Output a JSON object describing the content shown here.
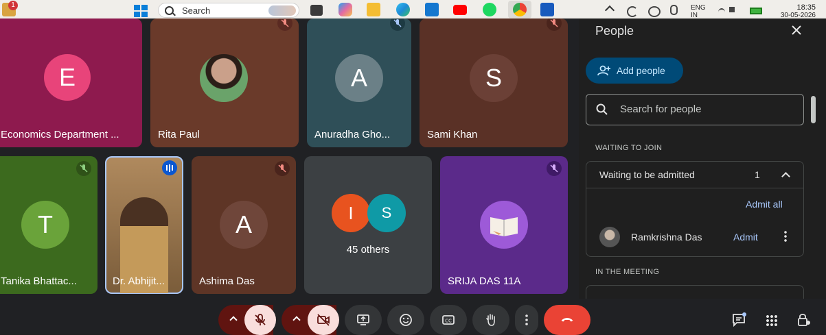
{
  "taskbar": {
    "notification_count": "1",
    "search_label": "Search",
    "lang_line1": "ENG",
    "lang_line2": "IN",
    "time": "18:35",
    "date": "30-05-2026"
  },
  "tiles": [
    {
      "name": "Economics Department ...",
      "initial": "E"
    },
    {
      "name": "Rita Paul"
    },
    {
      "name": "Anuradha Gho...",
      "initial": "A"
    },
    {
      "name": "Sami Khan",
      "initial": "S"
    },
    {
      "name": "Tanika Bhattac...",
      "initial": "T"
    },
    {
      "name": "Dr. Abhijit..."
    },
    {
      "name": "Ashima Das",
      "initial": "A"
    },
    {
      "name": "45 others",
      "initials": [
        "I",
        "S"
      ]
    },
    {
      "name": "SRIJA DAS 11A"
    }
  ],
  "panel": {
    "title": "People",
    "add_people_label": "Add people",
    "search_placeholder": "Search for people",
    "waiting_section": "WAITING TO JOIN",
    "waiting_header": "Waiting to be admitted",
    "waiting_count": "1",
    "admit_all_label": "Admit all",
    "waiting_person": "Ramkrishna Das",
    "admit_label": "Admit",
    "in_meeting_section": "IN THE MEETING"
  },
  "colors": {
    "end_call": "#ea4335",
    "mic_off_bg": "#f9dedc",
    "add_people_bg": "#004a77",
    "link": "#a8c7fa"
  }
}
